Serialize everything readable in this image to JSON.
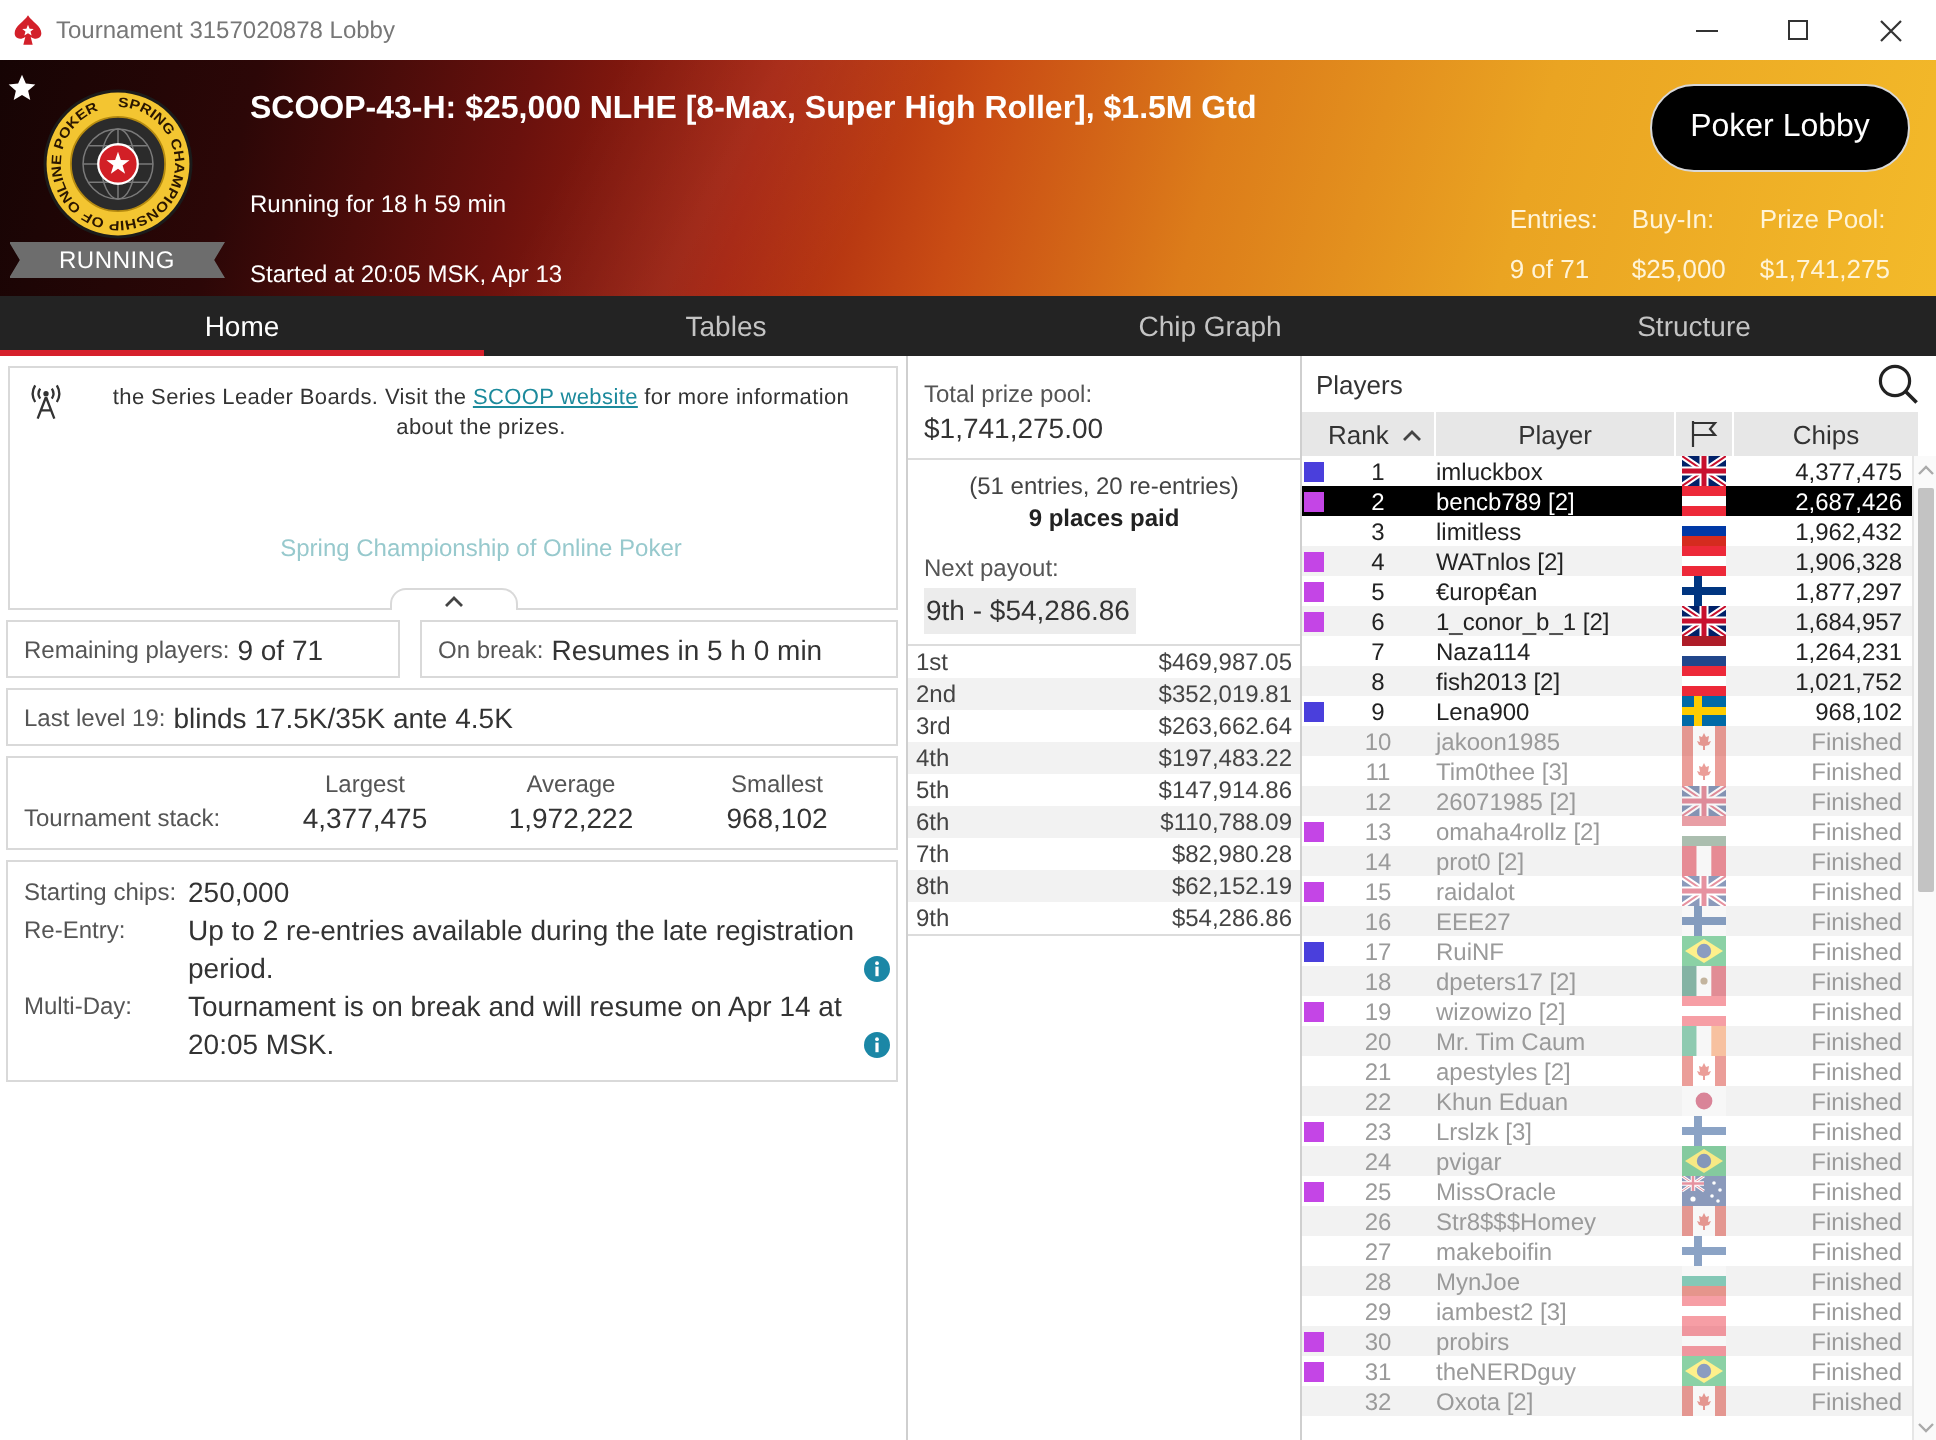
{
  "window": {
    "title": "Tournament 3157020878 Lobby"
  },
  "banner": {
    "emblem_text": "SPRING CHAMPIONSHIP OF ONLINE POKER",
    "status": "RUNNING",
    "title": "SCOOP-43-H: $25,000 NLHE [8-Max, Super High Roller], $1.5M Gtd",
    "running_for": "Running for 18 h 59 min",
    "started": "Started at 20:05 MSK, Apr 13",
    "lobby_button": "Poker Lobby",
    "stats": [
      {
        "label": "Entries:",
        "value": "9 of 71"
      },
      {
        "label": "Buy-In:",
        "value": "$25,000"
      },
      {
        "label": "Prize Pool:",
        "value": "$1,741,275"
      }
    ]
  },
  "tabs": [
    {
      "label": "Home",
      "selected": true
    },
    {
      "label": "Tables",
      "selected": false
    },
    {
      "label": "Chip Graph",
      "selected": false
    },
    {
      "label": "Structure",
      "selected": false
    }
  ],
  "home": {
    "news": {
      "text_before": "the Series Leader Boards. Visit the ",
      "link": "SCOOP website",
      "text_after": " for more information about the prizes.",
      "heading": "Spring Championship of Online Poker"
    },
    "remaining": {
      "label": "Remaining players:",
      "value": "9 of 71"
    },
    "on_break": {
      "label": "On break:",
      "value": "Resumes in 5 h 0 min"
    },
    "last_level": {
      "label": "Last level 19:",
      "value": "blinds 17.5K/35K ante 4.5K"
    },
    "stack": {
      "label": "Tournament stack:",
      "columns": [
        {
          "label": "Largest",
          "value": "4,377,475"
        },
        {
          "label": "Average",
          "value": "1,972,222"
        },
        {
          "label": "Smallest",
          "value": "968,102"
        }
      ]
    },
    "details": [
      {
        "label": "Starting chips:",
        "value": "250,000",
        "info": false
      },
      {
        "label": "Re-Entry:",
        "value": "Up to 2 re-entries available during the late registration period.",
        "info": true
      },
      {
        "label": "Multi-Day:",
        "value": "Tournament is on break and will resume on Apr 14 at 20:05 MSK.",
        "info": true
      }
    ]
  },
  "prizes": {
    "total_label": "Total prize pool:",
    "total": "$1,741,275.00",
    "entries_note": "(51 entries, 20 re-entries)",
    "places_paid": "9 places paid",
    "next_label": "Next payout:",
    "next_value": "9th - $54,286.86",
    "payouts": [
      {
        "place": "1st",
        "amount": "$469,987.05"
      },
      {
        "place": "2nd",
        "amount": "$352,019.81"
      },
      {
        "place": "3rd",
        "amount": "$263,662.64"
      },
      {
        "place": "4th",
        "amount": "$197,483.22"
      },
      {
        "place": "5th",
        "amount": "$147,914.86"
      },
      {
        "place": "6th",
        "amount": "$110,788.09"
      },
      {
        "place": "7th",
        "amount": "$82,980.28"
      },
      {
        "place": "8th",
        "amount": "$62,152.19"
      },
      {
        "place": "9th",
        "amount": "$54,286.86"
      }
    ]
  },
  "players": {
    "title": "Players",
    "columns": [
      {
        "kind": "text",
        "label": "Rank",
        "sorted": true
      },
      {
        "kind": "text",
        "label": "Player",
        "sorted": false
      },
      {
        "kind": "flag",
        "sorted": false
      },
      {
        "kind": "text",
        "label": "Chips",
        "sorted": false
      }
    ],
    "rows": [
      {
        "rank": "1",
        "name": "imluckbox",
        "flag": {
          "kind": "uk"
        },
        "chips": "4,377,475",
        "color": "#4a3fdc",
        "selected": false,
        "eliminated": false
      },
      {
        "rank": "2",
        "name": "bencb789 [2]",
        "flag": {
          "kind": "austria"
        },
        "chips": "2,687,426",
        "color": "#c445e6",
        "selected": true,
        "eliminated": false
      },
      {
        "rank": "3",
        "name": "limitless",
        "flag": {
          "kind": "russia"
        },
        "chips": "1,962,432",
        "selected": false,
        "eliminated": false
      },
      {
        "rank": "4",
        "name": "WATnlos [2]",
        "flag": {
          "kind": "austria"
        },
        "chips": "1,906,328",
        "color": "#c445e6",
        "selected": false,
        "eliminated": false
      },
      {
        "rank": "5",
        "name": "€urop€an",
        "flag": {
          "kind": "finland"
        },
        "chips": "1,877,297",
        "color": "#c445e6",
        "selected": false,
        "eliminated": false
      },
      {
        "rank": "6",
        "name": "1_conor_b_1 [2]",
        "flag": {
          "kind": "uk"
        },
        "chips": "1,684,957",
        "color": "#c445e6",
        "selected": false,
        "eliminated": false
      },
      {
        "rank": "7",
        "name": "Naza114",
        "flag": {
          "kind": "netherlands"
        },
        "chips": "1,264,231",
        "selected": false,
        "eliminated": false
      },
      {
        "rank": "8",
        "name": "fish2013 [2]",
        "flag": {
          "kind": "austria"
        },
        "chips": "1,021,752",
        "selected": false,
        "eliminated": false
      },
      {
        "rank": "9",
        "name": "Lena900",
        "flag": {
          "kind": "sweden"
        },
        "chips": "968,102",
        "color": "#4a3fdc",
        "selected": false,
        "eliminated": false
      },
      {
        "rank": "10",
        "name": "jakoon1985",
        "flag": {
          "kind": "canada"
        },
        "chips": "Finished",
        "selected": false,
        "eliminated": true
      },
      {
        "rank": "11",
        "name": "Tim0thee [3]",
        "flag": {
          "kind": "canada"
        },
        "chips": "Finished",
        "selected": false,
        "eliminated": true
      },
      {
        "rank": "12",
        "name": "26071985 [2]",
        "flag": {
          "kind": "uk"
        },
        "chips": "Finished",
        "selected": false,
        "eliminated": true
      },
      {
        "rank": "13",
        "name": "omaha4rollz [2]",
        "flag": {
          "kind": "hungary"
        },
        "chips": "Finished",
        "color": "#c445e6",
        "selected": false,
        "eliminated": true
      },
      {
        "rank": "14",
        "name": "prot0 [2]",
        "flag": {
          "kind": "peru"
        },
        "chips": "Finished",
        "selected": false,
        "eliminated": true
      },
      {
        "rank": "15",
        "name": "raidalot",
        "flag": {
          "kind": "uk"
        },
        "chips": "Finished",
        "color": "#c445e6",
        "selected": false,
        "eliminated": true
      },
      {
        "rank": "16",
        "name": "EEE27",
        "flag": {
          "kind": "finland"
        },
        "chips": "Finished",
        "selected": false,
        "eliminated": true
      },
      {
        "rank": "17",
        "name": "RuiNF",
        "flag": {
          "kind": "brazil"
        },
        "chips": "Finished",
        "color": "#4a3fdc",
        "selected": false,
        "eliminated": true
      },
      {
        "rank": "18",
        "name": "dpeters17 [2]",
        "flag": {
          "kind": "mexico"
        },
        "chips": "Finished",
        "selected": false,
        "eliminated": true
      },
      {
        "rank": "19",
        "name": "wizowizo [2]",
        "flag": {
          "kind": "austria"
        },
        "chips": "Finished",
        "color": "#c445e6",
        "selected": false,
        "eliminated": true
      },
      {
        "rank": "20",
        "name": "Mr. Tim Caum",
        "flag": {
          "kind": "ireland"
        },
        "chips": "Finished",
        "selected": false,
        "eliminated": true
      },
      {
        "rank": "21",
        "name": "apestyles [2]",
        "flag": {
          "kind": "canada"
        },
        "chips": "Finished",
        "selected": false,
        "eliminated": true
      },
      {
        "rank": "22",
        "name": "Khun Eduan",
        "flag": {
          "kind": "japan"
        },
        "chips": "Finished",
        "selected": false,
        "eliminated": true
      },
      {
        "rank": "23",
        "name": "Lrslzk [3]",
        "flag": {
          "kind": "finland"
        },
        "chips": "Finished",
        "color": "#c445e6",
        "selected": false,
        "eliminated": true
      },
      {
        "rank": "24",
        "name": "pvigar",
        "flag": {
          "kind": "brazil"
        },
        "chips": "Finished",
        "selected": false,
        "eliminated": true
      },
      {
        "rank": "25",
        "name": "MissOracle",
        "flag": {
          "kind": "australia"
        },
        "chips": "Finished",
        "color": "#c445e6",
        "selected": false,
        "eliminated": true
      },
      {
        "rank": "26",
        "name": "Str8$$$Homey",
        "flag": {
          "kind": "canada"
        },
        "chips": "Finished",
        "selected": false,
        "eliminated": true
      },
      {
        "rank": "27",
        "name": "makeboifin",
        "flag": {
          "kind": "finland"
        },
        "chips": "Finished",
        "selected": false,
        "eliminated": true
      },
      {
        "rank": "28",
        "name": "MynJoe",
        "flag": {
          "kind": "bulgaria"
        },
        "chips": "Finished",
        "selected": false,
        "eliminated": true
      },
      {
        "rank": "29",
        "name": "iambest2 [3]",
        "flag": {
          "kind": "austria"
        },
        "chips": "Finished",
        "selected": false,
        "eliminated": true
      },
      {
        "rank": "30",
        "name": "probirs",
        "flag": {
          "kind": "austria"
        },
        "chips": "Finished",
        "color": "#c445e6",
        "selected": false,
        "eliminated": true
      },
      {
        "rank": "31",
        "name": "theNERDguy",
        "flag": {
          "kind": "brazil"
        },
        "chips": "Finished",
        "color": "#c445e6",
        "selected": false,
        "eliminated": true
      },
      {
        "rank": "32",
        "name": "Oxota [2]",
        "flag": {
          "kind": "canada"
        },
        "chips": "Finished",
        "selected": false,
        "eliminated": true
      }
    ]
  }
}
